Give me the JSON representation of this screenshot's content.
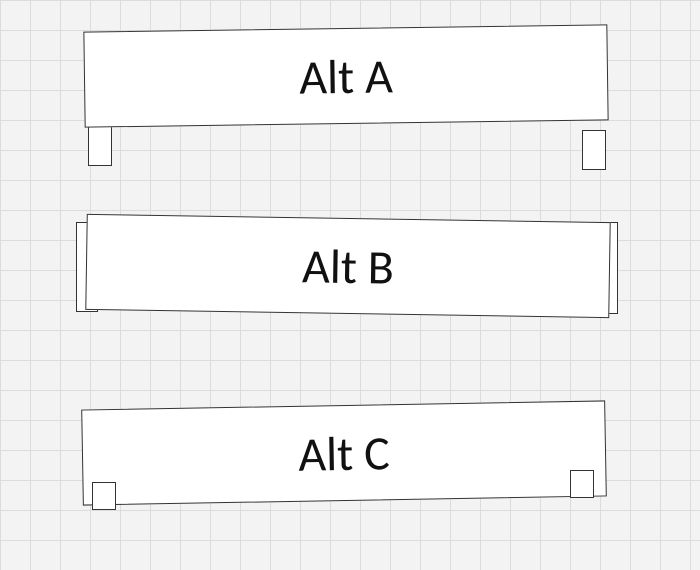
{
  "alts": {
    "a": {
      "label": "Alt A"
    },
    "b": {
      "label": "Alt B"
    },
    "c": {
      "label": "Alt C"
    }
  }
}
